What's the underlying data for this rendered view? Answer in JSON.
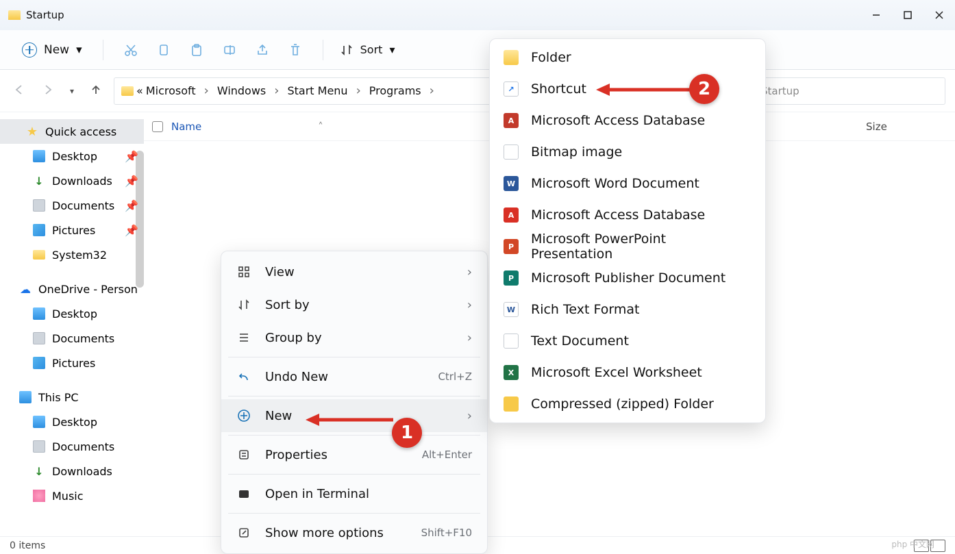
{
  "window": {
    "title": "Startup"
  },
  "toolbar": {
    "new_label": "New",
    "sort_label": "Sort"
  },
  "breadcrumb": {
    "ellipsis": "«",
    "items": [
      "Microsoft",
      "Windows",
      "Start Menu",
      "Programs"
    ],
    "search_prefix": "Startup"
  },
  "columns": {
    "name": "Name",
    "size": "Size"
  },
  "sidebar": {
    "quick_access": "Quick access",
    "quick_items": [
      {
        "icon": "monitor",
        "label": "Desktop",
        "pinned": true
      },
      {
        "icon": "darrow",
        "label": "Downloads",
        "pinned": true
      },
      {
        "icon": "doc",
        "label": "Documents",
        "pinned": true
      },
      {
        "icon": "pic",
        "label": "Pictures",
        "pinned": true
      },
      {
        "icon": "folder",
        "label": "System32",
        "pinned": false
      }
    ],
    "onedrive": {
      "label": "OneDrive - Person",
      "items": [
        {
          "icon": "monitor",
          "label": "Desktop"
        },
        {
          "icon": "doc",
          "label": "Documents"
        },
        {
          "icon": "pic",
          "label": "Pictures"
        }
      ]
    },
    "thispc": {
      "label": "This PC",
      "items": [
        {
          "icon": "monitor",
          "label": "Desktop"
        },
        {
          "icon": "doc",
          "label": "Documents"
        },
        {
          "icon": "darrow",
          "label": "Downloads"
        },
        {
          "icon": "music",
          "label": "Music"
        }
      ]
    }
  },
  "context_menu": {
    "view": "View",
    "sort_by": "Sort by",
    "group_by": "Group by",
    "undo": "Undo New",
    "undo_accel": "Ctrl+Z",
    "new": "New",
    "properties": "Properties",
    "properties_accel": "Alt+Enter",
    "terminal": "Open in Terminal",
    "more": "Show more options",
    "more_accel": "Shift+F10"
  },
  "new_submenu": [
    {
      "icon": "folder",
      "label": "Folder"
    },
    {
      "icon": "shortcut",
      "label": "Shortcut"
    },
    {
      "icon": "access",
      "label": "Microsoft Access Database"
    },
    {
      "icon": "bmp",
      "label": "Bitmap image"
    },
    {
      "icon": "word",
      "label": "Microsoft Word Document"
    },
    {
      "icon": "pdf",
      "label": "Microsoft Access Database"
    },
    {
      "icon": "ppt",
      "label": "Microsoft PowerPoint Presentation"
    },
    {
      "icon": "pub",
      "label": "Microsoft Publisher Document"
    },
    {
      "icon": "rtf",
      "label": "Rich Text Format"
    },
    {
      "icon": "txt",
      "label": "Text Document"
    },
    {
      "icon": "xls",
      "label": "Microsoft Excel Worksheet"
    },
    {
      "icon": "zip",
      "label": "Compressed (zipped) Folder"
    }
  ],
  "annotations": {
    "badge1": "1",
    "badge2": "2"
  },
  "status": {
    "items": "0 items"
  },
  "watermark": "php 中文网"
}
